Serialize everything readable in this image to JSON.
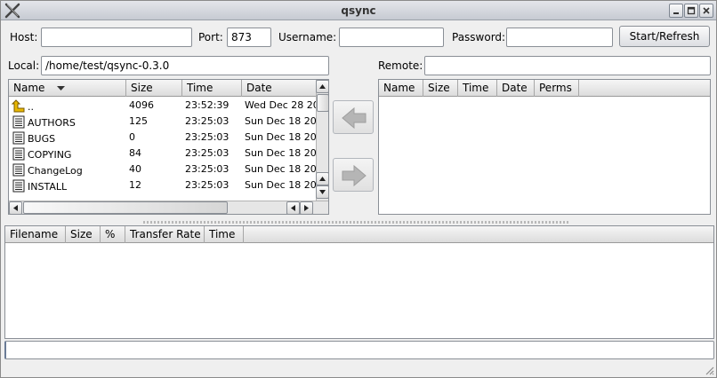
{
  "window": {
    "title": "qsync"
  },
  "connection": {
    "host_label": "Host:",
    "host_value": "",
    "port_label": "Port:",
    "port_value": "873",
    "username_label": "Username:",
    "username_value": "",
    "password_label": "Password:",
    "password_value": "",
    "start_button": "Start/Refresh"
  },
  "local": {
    "label": "Local:",
    "path": "/home/test/qsync-0.3.0",
    "columns": [
      "Name",
      "Size",
      "Time",
      "Date"
    ],
    "rows": [
      {
        "name": "..",
        "size": "4096",
        "time": "23:52:39",
        "date": "Wed Dec 28 20",
        "icon": "folder-up-icon"
      },
      {
        "name": "AUTHORS",
        "size": "125",
        "time": "23:25:03",
        "date": "Sun Dec 18 20",
        "icon": "document-icon"
      },
      {
        "name": "BUGS",
        "size": "0",
        "time": "23:25:03",
        "date": "Sun Dec 18 20",
        "icon": "document-icon"
      },
      {
        "name": "COPYING",
        "size": "84",
        "time": "23:25:03",
        "date": "Sun Dec 18 20",
        "icon": "document-icon"
      },
      {
        "name": "ChangeLog",
        "size": "40",
        "time": "23:25:03",
        "date": "Sun Dec 18 20",
        "icon": "document-icon"
      },
      {
        "name": "INSTALL",
        "size": "12",
        "time": "23:25:03",
        "date": "Sun Dec 18 20",
        "icon": "document-icon"
      }
    ]
  },
  "remote": {
    "label": "Remote:",
    "path": "",
    "columns": [
      "Name",
      "Size",
      "Time",
      "Date",
      "Perms"
    ]
  },
  "transfers": {
    "columns": [
      "Filename",
      "Size",
      "%",
      "Transfer Rate",
      "Time"
    ]
  },
  "command": {
    "value": ""
  },
  "colors": {
    "arrow_disabled": "#b0b0b0",
    "folder_up": "#e8b800"
  }
}
